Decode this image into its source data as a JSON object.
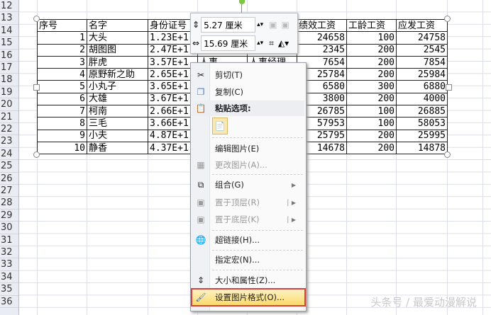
{
  "row_numbers": [
    "12",
    "13",
    "14",
    "15",
    "16",
    "17",
    "18",
    "19",
    "20",
    "21",
    "22",
    "23",
    "24",
    "25",
    "26",
    "27",
    "28",
    "29",
    "30",
    "31",
    "32",
    "33",
    "34",
    "35",
    "36"
  ],
  "table": {
    "headers": [
      "序号",
      "名字",
      "身份证号",
      "",
      "",
      "绩效工资",
      "工龄工资",
      "应发工资"
    ],
    "rows": [
      [
        "1",
        "大头",
        "1.23E+1",
        "",
        "",
        "24658",
        "100",
        "24758"
      ],
      [
        "2",
        "胡图图",
        "2.47E+1",
        "",
        "",
        "2345",
        "200",
        "2545"
      ],
      [
        "3",
        "胖虎",
        "3.57E+1",
        "人事",
        "人事经理",
        "7654",
        "200",
        "7854"
      ],
      [
        "4",
        "原野新之助",
        "2.65E+1",
        "",
        "",
        "25784",
        "200",
        "25984"
      ],
      [
        "5",
        "小丸子",
        "3.65E+1",
        "",
        "",
        "6580",
        "300",
        "6880"
      ],
      [
        "6",
        "大雄",
        "3.67E+1",
        "",
        "",
        "3800",
        "200",
        "4000"
      ],
      [
        "7",
        "柯南",
        "2.66E+1",
        "",
        "",
        "26785",
        "100",
        "26885"
      ],
      [
        "8",
        "三毛",
        "3.66E+1",
        "",
        "",
        "57953",
        "100",
        "58053"
      ],
      [
        "9",
        "小夫",
        "4.87E+1",
        "",
        "",
        "25795",
        "200",
        "25995"
      ],
      [
        "10",
        "静香",
        "4.37E+1",
        "",
        "",
        "14678",
        "200",
        "14878"
      ]
    ]
  },
  "mini_toolbar": {
    "height": "5.27 厘米",
    "width": "15.69 厘米"
  },
  "menu": {
    "cut": "剪切(T)",
    "copy": "复制(C)",
    "paste_options": "粘贴选项:",
    "edit_picture": "编辑图片(E)",
    "change_picture": "更改图片(A)...",
    "group": "组合(G)",
    "bring_front": "置于顶层(R)",
    "send_back": "置于底层(K)",
    "hyperlink": "超链接(H)...",
    "assign_macro": "指定宏(N)...",
    "size_props": "大小和属性(Z)...",
    "format_picture": "设置图片格式(O)..."
  },
  "watermark": "头条号 / 最爱动漫解说",
  "colors": {
    "highlight_border": "#d9413d",
    "highlight_fill": "#fbd96b"
  }
}
